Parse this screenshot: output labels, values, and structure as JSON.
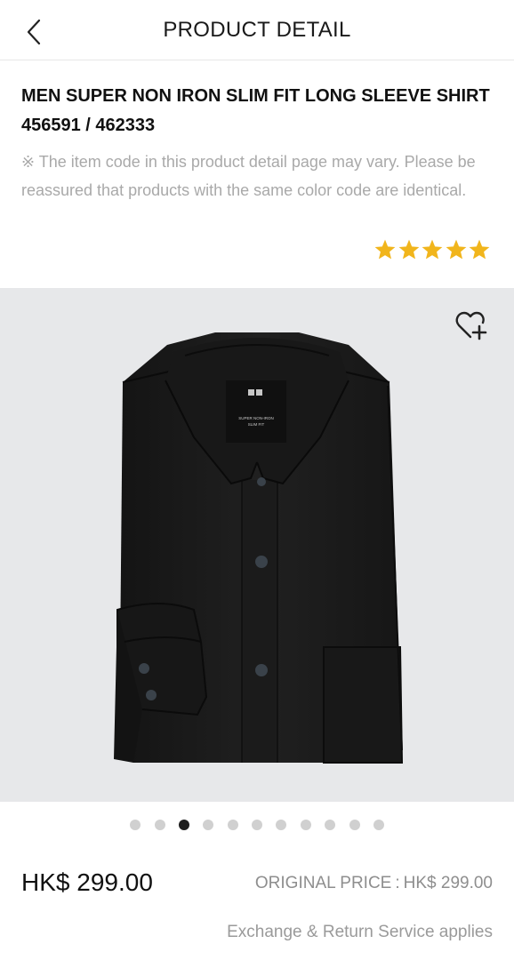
{
  "header": {
    "title": "PRODUCT DETAIL",
    "back_icon": "chevron-left-icon"
  },
  "product": {
    "name": "MEN SUPER NON IRON SLIM FIT LONG SLEEVE SHIRT 456591 / 462333",
    "notice": "※ The item code in this product detail page may vary. Please be reassured that products with the same color code are identical.",
    "rating": 5,
    "rating_color": "#f1b51c"
  },
  "gallery": {
    "wishlist_icon": "heart-plus-icon",
    "background": "#e7e8ea",
    "total_images": 11,
    "active_index": 2,
    "label_brand": "UNIQLO",
    "label_text_1": "SUPER NON-IRON",
    "label_text_2": "SLIM FIT"
  },
  "pricing": {
    "price": "HK$ 299.00",
    "original_label": "ORIGINAL PRICE",
    "original_sep": ":",
    "original_value": "HK$ 299.00",
    "service": "Exchange & Return Service applies"
  }
}
